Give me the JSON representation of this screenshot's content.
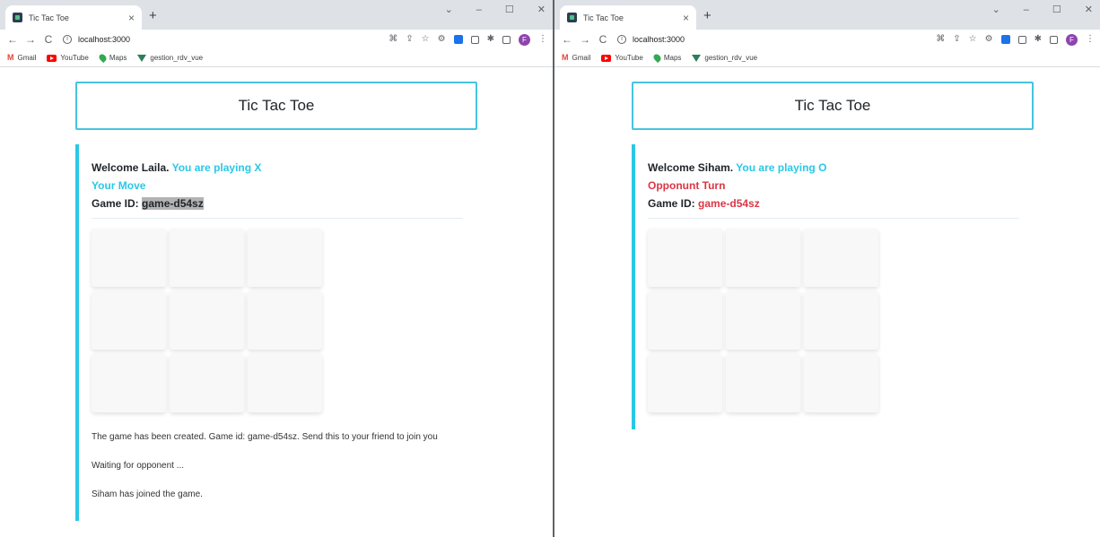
{
  "left": {
    "tab_title": "Tic Tac Toe",
    "url": "localhost:3000",
    "bookmarks": [
      "Gmail",
      "YouTube",
      "Maps",
      "gestion_rdv_vue"
    ],
    "profile_initial": "F",
    "header_title": "Tic Tac Toe",
    "welcome_prefix": "Welcome Laila.",
    "playing": "You are playing X",
    "turn": "Your Move",
    "game_id_label": "Game ID:",
    "game_id": "game-d54sz",
    "messages": [
      "The game has been created. Game id: game-d54sz. Send this to your friend to join you",
      "Waiting for opponent ...",
      "Siham has joined the game."
    ]
  },
  "right": {
    "tab_title": "Tic Tac Toe",
    "url": "localhost:3000",
    "bookmarks": [
      "Gmail",
      "YouTube",
      "Maps",
      "gestion_rdv_vue"
    ],
    "profile_initial": "F",
    "header_title": "Tic Tac Toe",
    "welcome_prefix": "Welcome Siham.",
    "playing": "You are playing O",
    "turn": "Opponunt Turn",
    "game_id_label": "Game ID:",
    "game_id": "game-d54sz"
  },
  "colors": {
    "accent": "#29c8e6",
    "danger": "#dc3545",
    "header_border": "#44c4e0"
  }
}
